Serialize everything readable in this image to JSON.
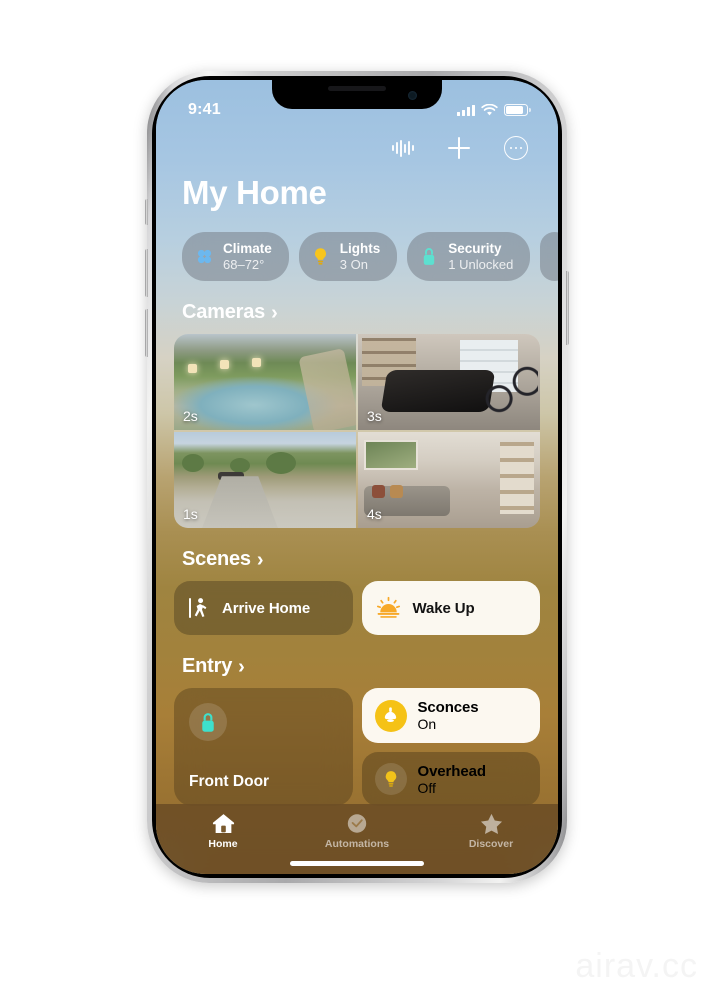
{
  "status_bar": {
    "time": "9:41",
    "icons": [
      "cellular-signal-icon",
      "wifi-icon",
      "battery-icon"
    ]
  },
  "header": {
    "title": "My Home",
    "icons": [
      {
        "name": "audio-waveform-icon"
      },
      {
        "name": "add-icon"
      },
      {
        "name": "more-options-icon"
      }
    ]
  },
  "status_pills": [
    {
      "icon": "climate-fan-icon",
      "title": "Climate",
      "subtitle": "68–72°"
    },
    {
      "icon": "lightbulb-icon",
      "title": "Lights",
      "subtitle": "3 On"
    },
    {
      "icon": "lock-icon",
      "title": "Security",
      "subtitle": "1 Unlocked"
    }
  ],
  "sections": {
    "cameras": {
      "title": "Cameras",
      "chevron": "›",
      "tiles": [
        {
          "name": "camera-pool",
          "badge": "2s"
        },
        {
          "name": "camera-garage-gym",
          "badge": "3s"
        },
        {
          "name": "camera-driveway",
          "badge": "1s"
        },
        {
          "name": "camera-living-room",
          "badge": "4s"
        }
      ]
    },
    "scenes": {
      "title": "Scenes",
      "chevron": "›",
      "tiles": [
        {
          "name": "scene-arrive-home",
          "label": "Arrive Home",
          "icon": "walking-person-icon",
          "style": "dark"
        },
        {
          "name": "scene-wake-up",
          "label": "Wake Up",
          "icon": "sunrise-icon",
          "style": "light"
        }
      ]
    },
    "entry": {
      "title": "Entry",
      "chevron": "›",
      "front_door": {
        "name": "Front Door",
        "icon": "lock-icon"
      },
      "accessories": [
        {
          "name": "Sconces",
          "state": "On",
          "icon": "wall-sconce-icon",
          "style": "light"
        },
        {
          "name": "Overhead",
          "state": "Off",
          "icon": "lightbulb-icon",
          "style": "dark"
        }
      ]
    }
  },
  "tab_bar": [
    {
      "name": "tab-home",
      "label": "Home",
      "icon": "house-icon",
      "active": true
    },
    {
      "name": "tab-automations",
      "label": "Automations",
      "icon": "clock-icon",
      "active": false
    },
    {
      "name": "tab-discover",
      "label": "Discover",
      "icon": "star-icon",
      "active": false
    }
  ],
  "watermark": "airav.cc",
  "colors": {
    "accent_yellow": "#f5c216",
    "lock_teal": "#5de0d0",
    "climate_blue": "#6cb8ef",
    "tabbar_brown": "#684a24"
  }
}
